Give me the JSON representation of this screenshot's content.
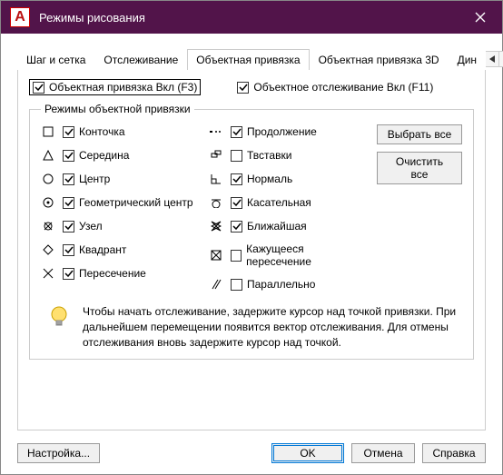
{
  "title": "Режимы рисования",
  "tabs": {
    "t0": "Шаг и сетка",
    "t1": "Отслеживание",
    "t2": "Объектная привязка",
    "t3": "Объектная привязка 3D",
    "t4": "Дин"
  },
  "top": {
    "osnap": "Объектная привязка Вкл (F3)",
    "otrack": "Объектное отслеживание Вкл (F11)"
  },
  "group_label": "Режимы объектной привязки",
  "left": {
    "m0": "Конточка",
    "m1": "Середина",
    "m2": "Центр",
    "m3": "Геометрический центр",
    "m4": "Узел",
    "m5": "Квадрант",
    "m6": "Пересечение"
  },
  "right": {
    "m0": "Продолжение",
    "m1": "Твставки",
    "m2": "Нормаль",
    "m3": "Касательная",
    "m4": "Ближайшая",
    "m5": "Кажущееся пересечение",
    "m6": "Параллельно"
  },
  "btns": {
    "selall": "Выбрать все",
    "clrall": "Очистить все"
  },
  "hint": "Чтобы начать отслеживание, задержите курсор над точкой привязки. При дальнейшем перемещении появится вектор отслеживания. Для отмены отслеживания вновь задержите курсор над точкой.",
  "footer": {
    "options": "Настройка...",
    "ok": "OK",
    "cancel": "Отмена",
    "help": "Справка"
  }
}
